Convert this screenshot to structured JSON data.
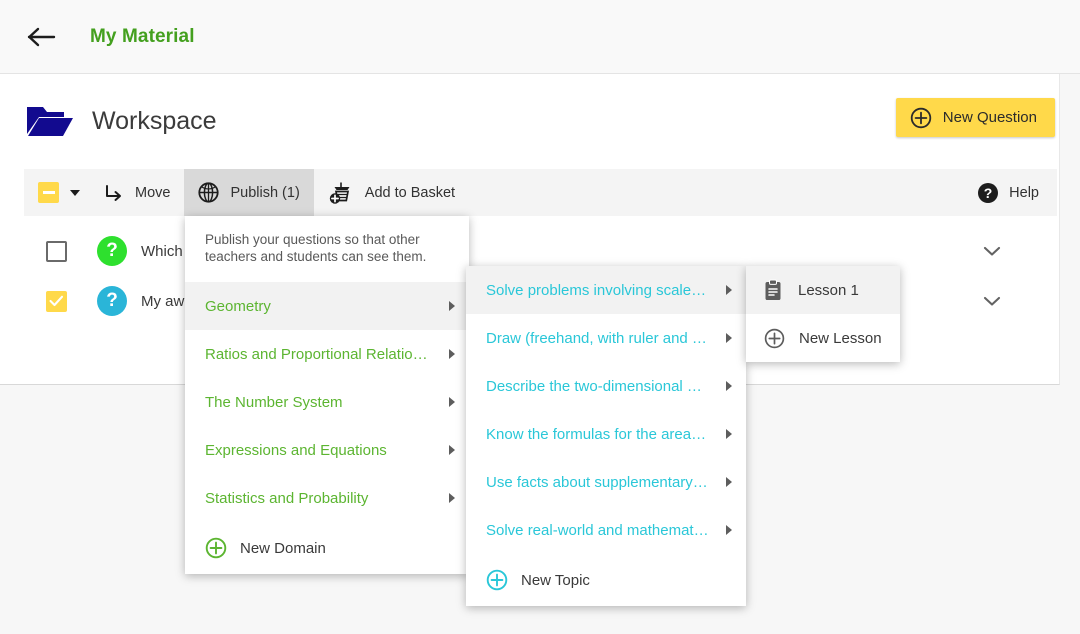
{
  "appbar": {
    "back_icon": "arrow-left-icon",
    "title": "My Material",
    "title_color": "#44a01f"
  },
  "workspace": {
    "folder_icon": "folder-open-icon",
    "title": "Workspace",
    "new_question": {
      "label": "New Question",
      "icon": "plus-circle-icon",
      "color": "#ffd94a"
    }
  },
  "toolbar": {
    "select_all": {
      "icon": "checkbox-indeterminate-icon",
      "caret": "caret-down-icon",
      "state": "indeterminate",
      "color": "#ffd94a"
    },
    "items": [
      {
        "label": "Move",
        "icon": "move-arrow-icon",
        "active": false
      },
      {
        "label": "Publish (1)",
        "icon": "globe-icon",
        "active": true
      },
      {
        "label": "Add to Basket",
        "icon": "basket-plus-icon",
        "active": false
      }
    ],
    "help": {
      "label": "Help",
      "icon": "help-circle-icon"
    }
  },
  "rows": [
    {
      "checked": false,
      "badge_icon": "question-mark-badge",
      "badge_char": "?",
      "badge_color": "#2ee02e",
      "title": "Which of",
      "chevron": "chevron-down-icon"
    },
    {
      "checked": true,
      "badge_icon": "question-mark-badge",
      "badge_char": "?",
      "badge_color": "#2ab5d8",
      "title": "My awes",
      "chevron": "chevron-down-icon"
    }
  ],
  "menu_domains": {
    "note": "Publish your questions so that other teachers and students can see them.",
    "items": [
      {
        "label": "Geometry",
        "hovered": true
      },
      {
        "label": "Ratios and Proportional Relatio…",
        "hovered": false
      },
      {
        "label": "The Number System",
        "hovered": false
      },
      {
        "label": "Expressions and Equations",
        "hovered": false
      },
      {
        "label": "Statistics and Probability",
        "hovered": false
      }
    ],
    "add": {
      "label": "New Domain",
      "icon": "plus-circle-icon",
      "color": "#5cb531"
    }
  },
  "menu_topics": {
    "items": [
      {
        "label": "Solve problems involving scale…",
        "hovered": true
      },
      {
        "label": "Draw (freehand, with ruler and …",
        "hovered": false
      },
      {
        "label": "Describe the two-dimensional …",
        "hovered": false
      },
      {
        "label": "Know the formulas for the area…",
        "hovered": false
      },
      {
        "label": "Use facts about supplementary…",
        "hovered": false
      },
      {
        "label": "Solve real-world and mathemat…",
        "hovered": false
      }
    ],
    "add": {
      "label": "New Topic",
      "icon": "plus-circle-icon",
      "color": "#2ac7d8"
    }
  },
  "menu_lessons": {
    "items": [
      {
        "label": "Lesson 1",
        "icon": "clipboard-icon",
        "hovered": true
      }
    ],
    "add": {
      "label": "New Lesson",
      "icon": "plus-circle-icon",
      "color": "#5d5d5d"
    }
  }
}
